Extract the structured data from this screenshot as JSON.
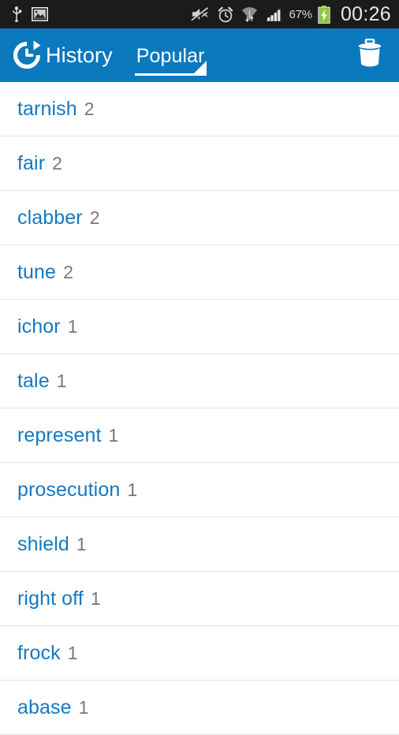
{
  "statusbar": {
    "icons_left": [
      "usb-icon",
      "screenshot-image-icon"
    ],
    "icons_right": [
      "mute-icon",
      "alarm-clock-icon",
      "wifi-transfer-icon",
      "signal-bars-icon"
    ],
    "battery_percent": "67%",
    "battery_state": "charging",
    "clock": "00:26",
    "background": "#1b1b1b"
  },
  "actionbar": {
    "app_icon": "history-clock-icon",
    "title": "History",
    "tab": {
      "label": "Popular",
      "selected": true
    },
    "delete_icon": "trash-icon",
    "background": "#0b79be",
    "foreground": "#ffffff"
  },
  "list": {
    "word_color": "#1678c2",
    "count_color": "#787878",
    "divider_color": "#e3e3e3",
    "items": [
      {
        "word": "tarnish",
        "count": "2"
      },
      {
        "word": "fair",
        "count": "2"
      },
      {
        "word": "clabber",
        "count": "2"
      },
      {
        "word": "tune",
        "count": "2"
      },
      {
        "word": "ichor",
        "count": "1"
      },
      {
        "word": "tale",
        "count": "1"
      },
      {
        "word": "represent",
        "count": "1"
      },
      {
        "word": "prosecution",
        "count": "1"
      },
      {
        "word": "shield",
        "count": "1"
      },
      {
        "word": "right off",
        "count": "1"
      },
      {
        "word": "frock",
        "count": "1"
      },
      {
        "word": "abase",
        "count": "1"
      }
    ]
  }
}
